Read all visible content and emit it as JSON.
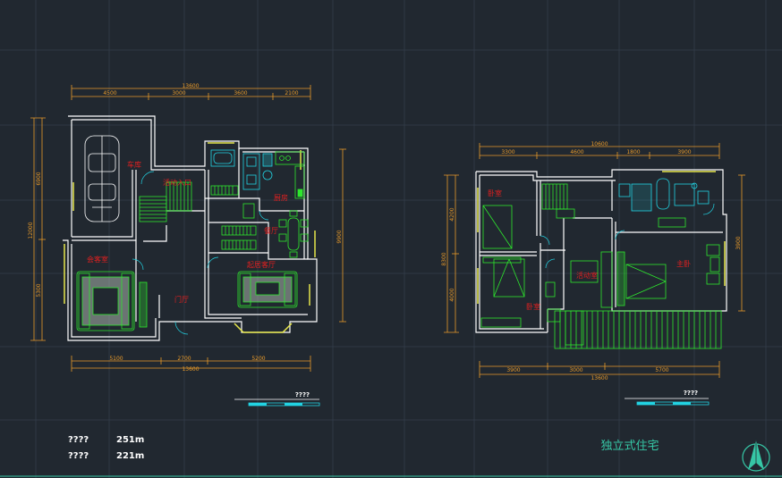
{
  "colors": {
    "background": "#212830",
    "grid": "#2f3945",
    "wall": "#ffffff",
    "dimension": "#e89a2a",
    "room_label": "#e02020",
    "furniture": "#2ee82e",
    "fixture": "#22d3e3",
    "window": "#e6e64a",
    "title": "#36c7a6"
  },
  "plan_ground": {
    "dims_top_total": "13600",
    "dims_top_parts": [
      "4500",
      "3000",
      "3600",
      "2100"
    ],
    "dims_bottom_parts": [
      "5100",
      "2700",
      "5200"
    ],
    "dims_bottom_total": "13600",
    "dims_left_outer": "12000",
    "dims_left_parts": [
      "6900",
      "5300"
    ],
    "dims_right": "9900",
    "rooms": {
      "garage": "车库",
      "stair_entry": "活动入口",
      "kitchen": "厨房",
      "dining": "餐厅",
      "guest": "会客室",
      "living": "起居客厅",
      "hall": "门厅"
    },
    "scale_label": "????"
  },
  "plan_upper": {
    "dims_top_total": "10600",
    "dims_top_parts": [
      "3300",
      "4600",
      "1800",
      "3900"
    ],
    "dims_bottom_parts": [
      "3900",
      "3000",
      "5700"
    ],
    "dims_bottom_total": "13600",
    "dims_left_outer": "8300",
    "dims_left_parts": [
      "4200",
      "4000"
    ],
    "dims_right": "3900",
    "rooms": {
      "bedroom1": "卧室",
      "bedroom2": "卧室",
      "activity": "活动室",
      "master": "主卧"
    },
    "scale_label": "????"
  },
  "areas": [
    {
      "label": "????",
      "value": "251m"
    },
    {
      "label": "????",
      "value": "221m"
    }
  ],
  "title": "独立式住宅",
  "north_icon": "north-arrow-icon"
}
